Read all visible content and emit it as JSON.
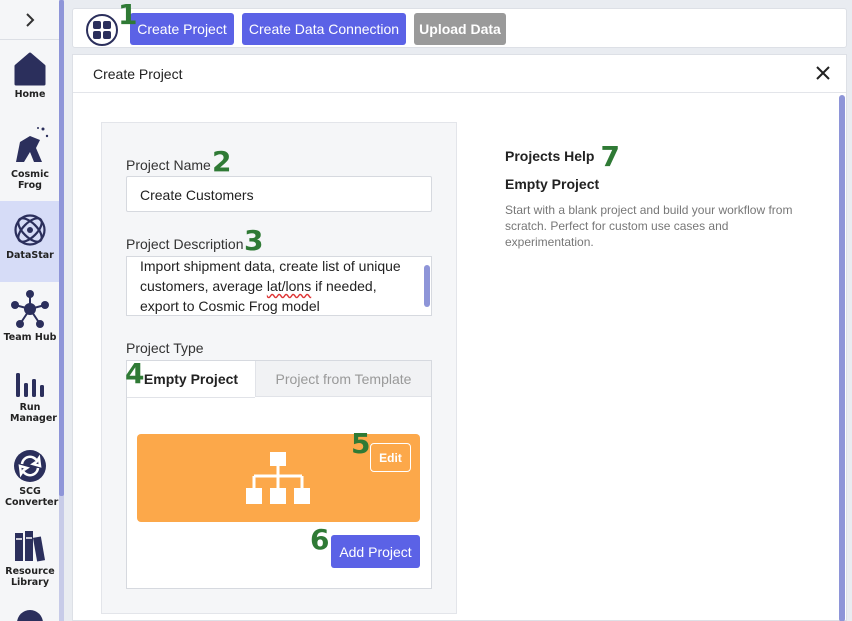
{
  "sidebar": {
    "collapse_glyph": "›",
    "items": [
      {
        "label": "Home",
        "icon": "home-icon"
      },
      {
        "label": "Cosmic Frog",
        "icon": "cosmic-frog-icon"
      },
      {
        "label": "DataStar",
        "icon": "datastar-icon",
        "active": true
      },
      {
        "label": "Team Hub",
        "icon": "team-hub-icon"
      },
      {
        "label": "Run Manager",
        "icon": "run-manager-icon"
      },
      {
        "label": "SCG Converter",
        "icon": "scg-converter-icon"
      },
      {
        "label": "Resource Library",
        "icon": "resource-library-icon"
      }
    ]
  },
  "toolbar": {
    "create_project": "Create Project",
    "create_data_connection": "Create Data Connection",
    "upload_data": "Upload Data"
  },
  "annotations": [
    "1",
    "2",
    "3",
    "4",
    "5",
    "6",
    "7"
  ],
  "panel": {
    "title": "Create Project",
    "project_name_label": "Project Name",
    "project_name_value": "Create Customers",
    "project_description_label": "Project Description",
    "description_line1": "Import shipment data, create list of unique",
    "description_line2_a": "customers, average ",
    "description_line2_b": "lat/lons",
    "description_line2_c": " if needed,",
    "description_line3": "export to Cosmic Frog model",
    "project_type_label": "Project Type",
    "tab_empty": "Empty Project",
    "tab_template": "Project from Template",
    "edit_label": "Edit",
    "add_project_label": "Add Project"
  },
  "help": {
    "title": "Projects Help",
    "subtitle": "Empty Project",
    "description": "Start with a blank project and build your workflow from scratch. Perfect for custom use cases and experimentation."
  },
  "colors": {
    "primary": "#5b62e6",
    "accent_orange": "#fca84a",
    "annotation_green": "#2f7a35",
    "active_nav": "#d6dcf7"
  }
}
